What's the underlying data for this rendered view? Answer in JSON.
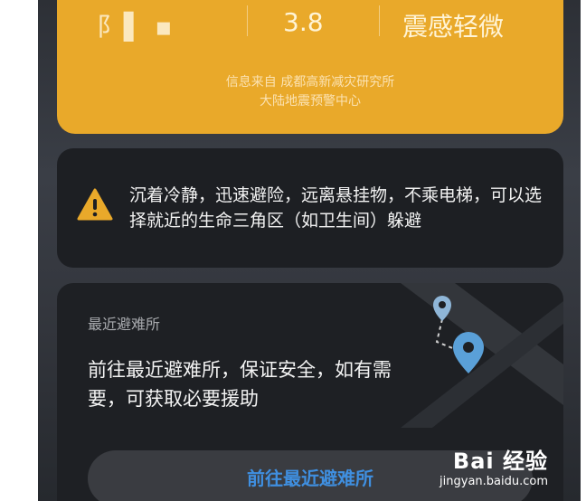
{
  "alert": {
    "location_value": "阝▌ ▪",
    "magnitude_value": "3.8",
    "intensity_value": "震感轻微",
    "source_line1": "信息来自 成都高新减灾研究所",
    "source_line2": "大陆地震预警中心"
  },
  "tip": {
    "icon": "warning-icon",
    "text": "沉着冷静，迅速避险，远离悬挂物，不乘电梯，可以选择就近的生命三角区（如卫生间）躲避"
  },
  "shelter": {
    "title": "最近避难所",
    "description": "前往最近避难所，保证安全，如有需要，可获取必要援助",
    "button_label": "前往最近避难所",
    "icons": [
      "map-icon",
      "location-pin-icon"
    ]
  },
  "watermark": {
    "main": "Bai 经验",
    "sub": "jingyan.baidu.com"
  },
  "colors": {
    "alert_bg": "#e9a92a",
    "card_bg": "#1d1f23",
    "button_text": "#3f8fe0",
    "pin": "#5aa0d8"
  }
}
